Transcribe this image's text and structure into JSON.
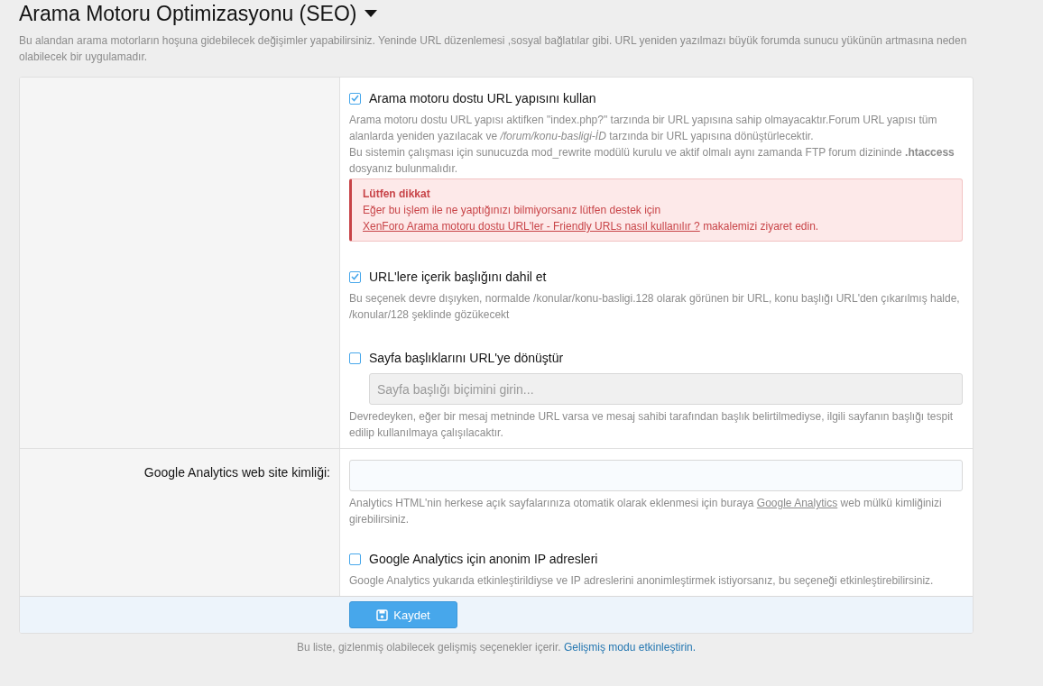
{
  "header": {
    "title": "Arama Motoru Optimizasyonu (SEO)",
    "description": "Bu alandan arama motorların hoşuna gidebilecek değişimler yapabilirsiniz. Yeninde URL düzenlemesi ,sosyal bağlatılar gibi. URL yeniden yazılmazı büyük forumda sunucu yükünün artmasına neden olabilecek bir uygulamadır."
  },
  "groups": [
    {
      "options": [
        {
          "kind": "checkbox",
          "label": "Arama motoru dostu URL yapısını kullan",
          "checked": true,
          "hint": [
            "Arama motoru dostu URL yapısı aktifken \"index.php?\" tarzında bir URL yapısına sahip olmayacaktır.Forum URL yapısı tüm alanlarda yeniden yazılacak ve */forum/konu-basligi-İD* tarzında bir URL yapısına dönüştürlecektir.",
            "Bu sistemin çalışması için sunucuzda mod_rewrite modülü kurulu ve aktif olmalı aynı zamanda FTP forum dizininde **.htaccess** dosyanız bulunmalıdır."
          ],
          "alert": {
            "title": "Lütfen dikkat",
            "before": "Eğer bu işlem ile ne yaptığınızı bilmiyorsanız lütfen destek için",
            "link": "XenForo Arama motoru dostu URL'ler - Friendly URLs nasıl kullanılır ?",
            "after": "makalemizi ziyaret edin."
          }
        },
        {
          "kind": "checkbox",
          "label": "URL'lere içerik başlığını dahil et",
          "checked": true,
          "hint": [
            "Bu seçenek devre dışıyken, normalde /konular/konu-basligi.128 olarak görünen bir URL, konu başlığı URL'den çıkarılmış halde, /konular/128 şeklinde gözükecekt"
          ]
        },
        {
          "kind": "checkbox",
          "label": "Sayfa başlıklarını URL'ye dönüştür",
          "checked": false,
          "input": {
            "placeholder": "Sayfa başlığı biçimini girin...",
            "disabled": true
          },
          "hint": [
            "Devredeyken, eğer bir mesaj metninde URL varsa ve mesaj sahibi tarafından başlık belirtilmediyse, ilgili sayfanın başlığı tespit edilip kullanılmaya çalışılacaktır."
          ]
        }
      ]
    },
    {
      "label": "Google Analytics web site kimliği:",
      "field": {
        "hint_before": "Analytics HTML'nin herkese açık sayfalarınıza otomatik olarak eklenmesi için buraya",
        "hint_link": "Google Analytics",
        "hint_after": "web mülkü kimliğinizi girebilirsiniz."
      },
      "options": [
        {
          "kind": "checkbox",
          "label": "Google Analytics için anonim IP adresleri",
          "checked": false,
          "hint": [
            "Google Analytics yukarıda etkinleştirildiyse ve IP adreslerini anonimleştirmek istiyorsanız, bu seçeneği etkinleştirebilirsiniz."
          ]
        }
      ]
    }
  ],
  "save_button": "Kaydet",
  "footer": {
    "text": "Bu liste, gizlenmiş olabilecek gelişmiş seçenekler içerir.",
    "link": "Gelişmiş modu etkinleştirin."
  }
}
